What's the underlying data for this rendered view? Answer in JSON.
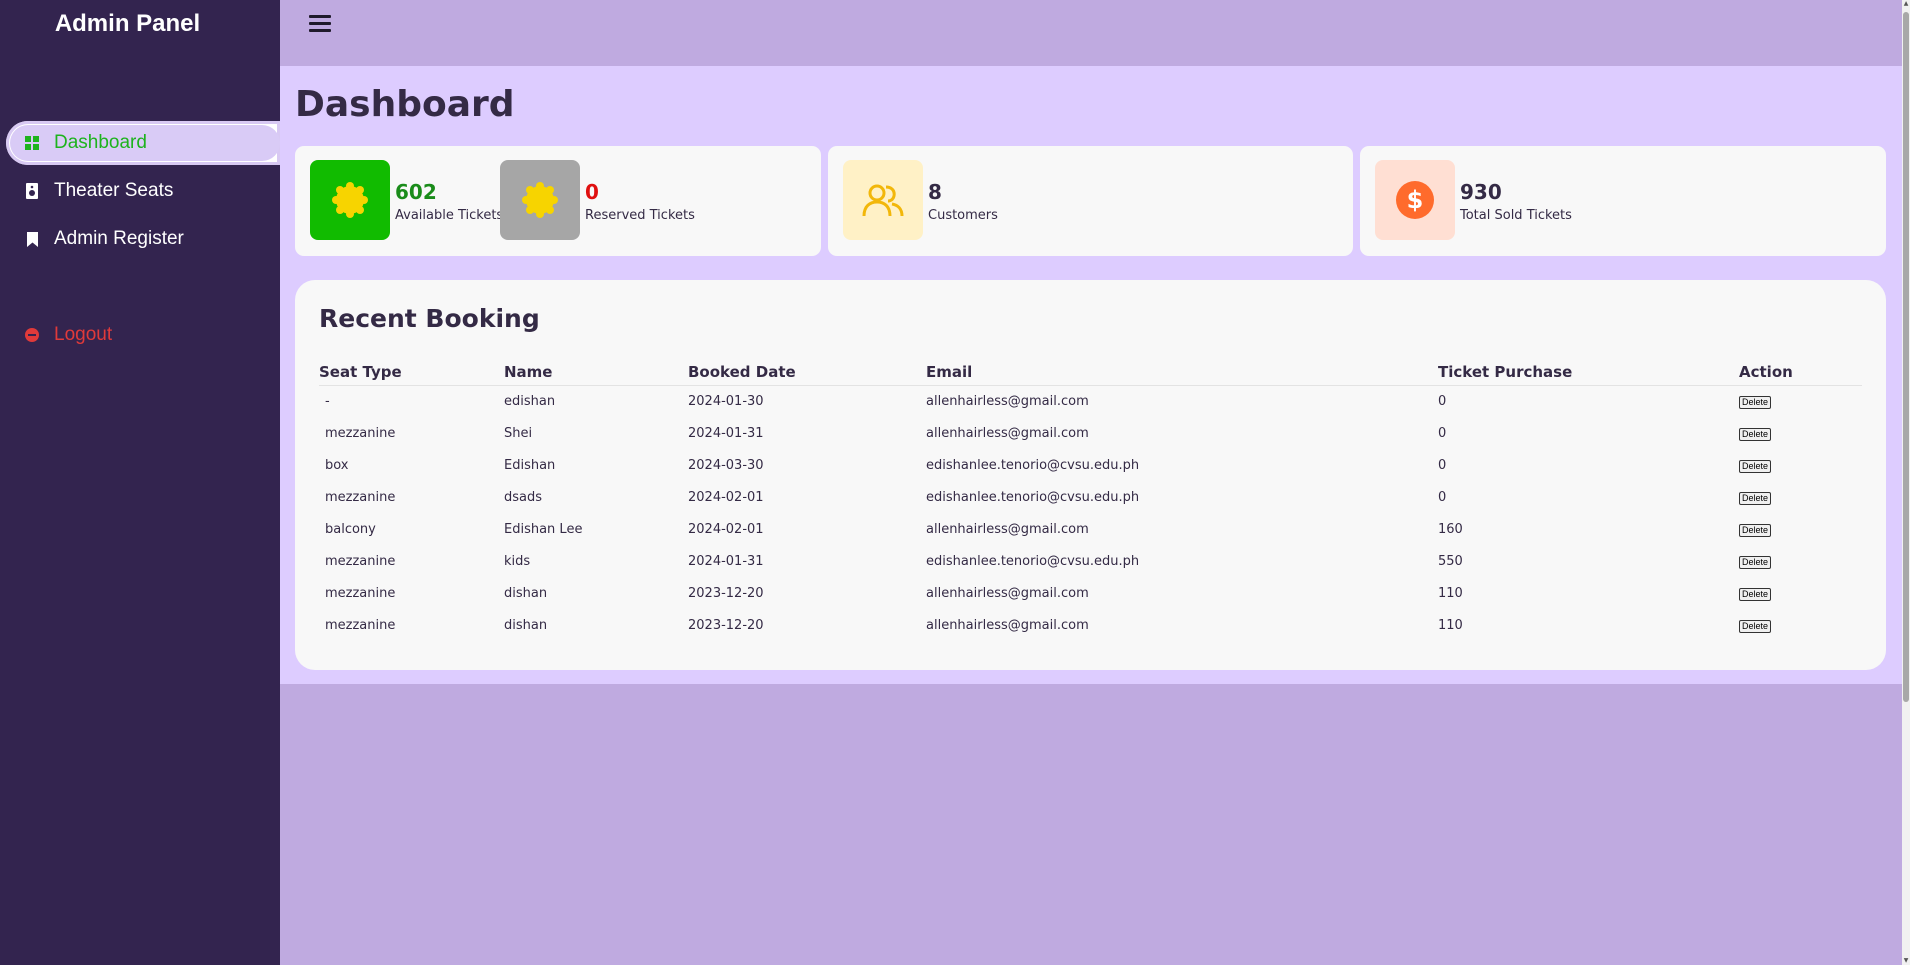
{
  "sidebar": {
    "brand": "Admin Panel",
    "items": [
      {
        "label": "Dashboard",
        "icon": "dashboard-grid-icon",
        "active": true
      },
      {
        "label": "Theater Seats",
        "icon": "speaker-icon"
      },
      {
        "label": "Admin Register",
        "icon": "bookmark-icon"
      }
    ],
    "logout": {
      "label": "Logout",
      "icon": "minus-circle-icon"
    }
  },
  "header": {
    "menu_icon": "hamburger-menu-icon"
  },
  "main": {
    "title": "Dashboard",
    "stats": [
      {
        "value": "602",
        "label": "Available Tickets",
        "color": "#1a8c1a",
        "icon": "sun-badge-icon",
        "box_color": "#11bb00"
      },
      {
        "value": "0",
        "label": "Reserved Tickets",
        "color": "#e01010",
        "icon": "sun-badge-icon",
        "box_color": "#a6a6a6"
      },
      {
        "value": "8",
        "label": "Customers",
        "color": "#342a45",
        "icon": "users-icon",
        "box_color": "#fff1c6"
      },
      {
        "value": "930",
        "label": "Total Sold Tickets",
        "color": "#342a45",
        "icon": "dollar-circle-icon",
        "box_color": "#ffdfd3"
      }
    ]
  },
  "recent": {
    "title": "Recent Booking",
    "columns": [
      "Seat Type",
      "Name",
      "Booked Date",
      "Email",
      "Ticket Purchase",
      "Action"
    ],
    "rows": [
      {
        "seat": "-",
        "name": "edishan",
        "date": "2024-01-30",
        "email": "allenhairless@gmail.com",
        "tickets": "0",
        "action": "Delete"
      },
      {
        "seat": "mezzanine",
        "name": "Shei",
        "date": "2024-01-31",
        "email": "allenhairless@gmail.com",
        "tickets": "0",
        "action": "Delete"
      },
      {
        "seat": "box",
        "name": "Edishan",
        "date": "2024-03-30",
        "email": "edishanlee.tenorio@cvsu.edu.ph",
        "tickets": "0",
        "action": "Delete"
      },
      {
        "seat": "mezzanine",
        "name": "dsads",
        "date": "2024-02-01",
        "email": "edishanlee.tenorio@cvsu.edu.ph",
        "tickets": "0",
        "action": "Delete"
      },
      {
        "seat": "balcony",
        "name": "Edishan Lee",
        "date": "2024-02-01",
        "email": "allenhairless@gmail.com",
        "tickets": "160",
        "action": "Delete"
      },
      {
        "seat": "mezzanine",
        "name": "kids",
        "date": "2024-01-31",
        "email": "edishanlee.tenorio@cvsu.edu.ph",
        "tickets": "550",
        "action": "Delete"
      },
      {
        "seat": "mezzanine",
        "name": "dishan",
        "date": "2023-12-20",
        "email": "allenhairless@gmail.com",
        "tickets": "110",
        "action": "Delete"
      },
      {
        "seat": "mezzanine",
        "name": "dishan",
        "date": "2023-12-20",
        "email": "allenhairless@gmail.com",
        "tickets": "110",
        "action": "Delete"
      }
    ]
  },
  "colors": {
    "sidebar_bg": "#33244f",
    "main_bg": "#ddccff",
    "topbar_bg": "#bfaae0",
    "active_text": "#1db31d",
    "logout_text": "#e03a3a"
  }
}
